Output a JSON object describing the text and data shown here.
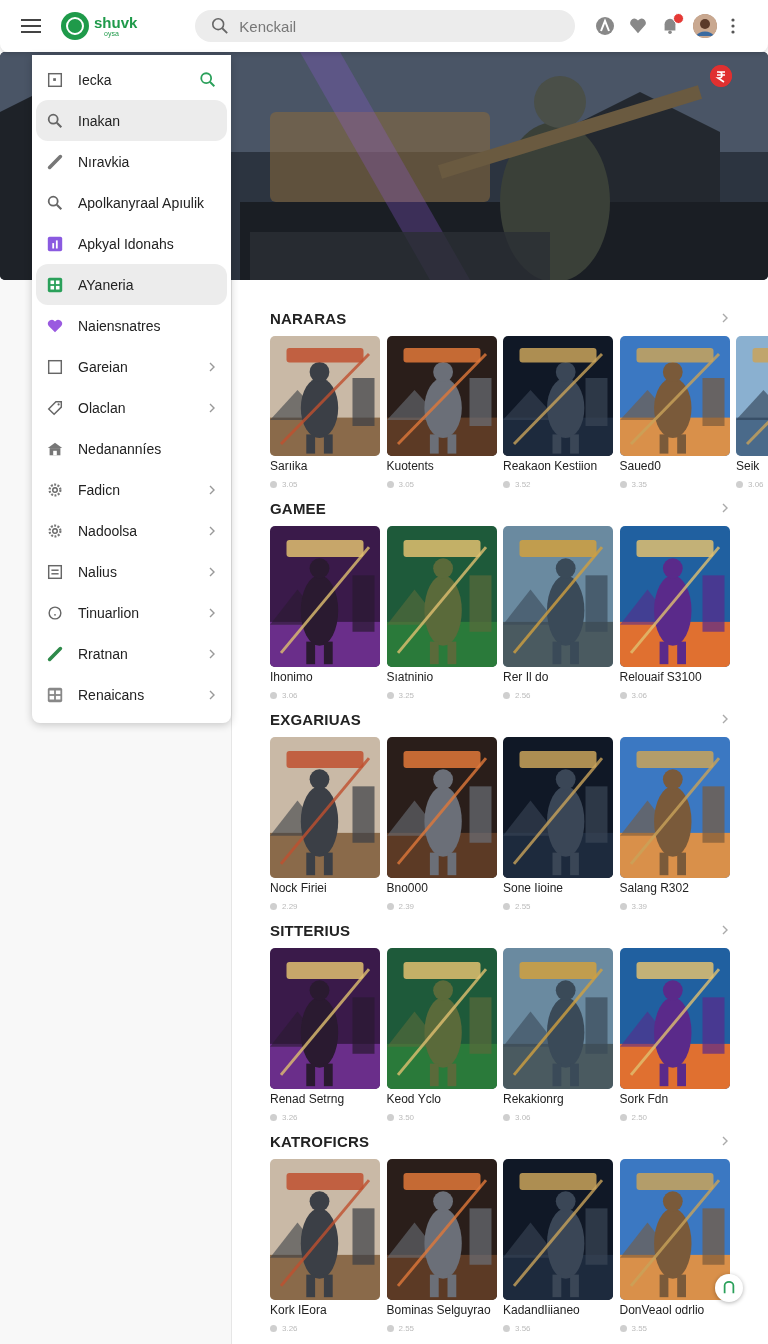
{
  "header": {
    "logo": {
      "name": "shuvk",
      "tagline": "oysa"
    },
    "search": {
      "placeholder": "Kenckail"
    },
    "has_unread_notifications": true
  },
  "menu": {
    "items": [
      {
        "label": "Iecka",
        "selected": false,
        "search_button": true,
        "chevron": false
      },
      {
        "label": "Inakan",
        "selected": true,
        "chevron": false
      },
      {
        "label": "Nıravkia",
        "selected": false,
        "chevron": false
      },
      {
        "label": "Apolkanyraal Apıulik",
        "selected": false,
        "chevron": false
      },
      {
        "label": "Apkyal Idonahs",
        "selected": false,
        "chevron": false
      },
      {
        "label": "AYaneria",
        "selected": true,
        "chevron": false
      },
      {
        "label": "Naiensnatres",
        "selected": false,
        "chevron": false
      },
      {
        "label": "Gareian",
        "selected": false,
        "chevron": true
      },
      {
        "label": "Olaclan",
        "selected": false,
        "chevron": true
      },
      {
        "label": "Nedananníes",
        "selected": false,
        "chevron": false
      },
      {
        "label": "Fadicn",
        "selected": false,
        "chevron": true
      },
      {
        "label": "Nadoolsa",
        "selected": false,
        "chevron": true
      },
      {
        "label": "Nalius",
        "selected": false,
        "chevron": true
      },
      {
        "label": "Tinuarlion",
        "selected": false,
        "chevron": true
      },
      {
        "label": "Rratnan",
        "selected": false,
        "chevron": true
      },
      {
        "label": "Renaicans",
        "selected": false,
        "chevron": true
      }
    ]
  },
  "sections": [
    {
      "title": "NARARAS",
      "kind": "landscape",
      "games": [
        {
          "title": "Sarıika",
          "rating": "3.05"
        },
        {
          "title": "Kuotents",
          "rating": "3.05"
        },
        {
          "title": "Reakaon Kestiion",
          "rating": "3.52"
        },
        {
          "title": "Saued0",
          "rating": "3.35"
        },
        {
          "title": "Seik",
          "rating": "3.06"
        }
      ]
    },
    {
      "title": "GAMEE",
      "kind": "portrait",
      "games": [
        {
          "title": "Ihonimo",
          "rating": "3.06"
        },
        {
          "title": "Sıatninio",
          "rating": "3.25"
        },
        {
          "title": "Rer Il do",
          "rating": "2.56"
        },
        {
          "title": "Relouaif S3100",
          "rating": "3.06"
        }
      ]
    },
    {
      "title": "EXGARIUAS",
      "kind": "portrait",
      "games": [
        {
          "title": "Nock Firiei",
          "rating": "2.29"
        },
        {
          "title": "Bno000",
          "rating": "2.39"
        },
        {
          "title": "Sone Iioine",
          "rating": "2.55"
        },
        {
          "title": "Salang R302",
          "rating": "3.39"
        }
      ]
    },
    {
      "title": "SITTERIUS",
      "kind": "portrait",
      "games": [
        {
          "title": "Renad Setrng",
          "rating": "3.26"
        },
        {
          "title": "Keod Yclo",
          "rating": "3.50"
        },
        {
          "title": "Rekakionrg",
          "rating": "3.06"
        },
        {
          "title": "Sork Fdn",
          "rating": "2.50"
        }
      ]
    },
    {
      "title": "KATROFICRS",
      "kind": "portrait",
      "games": [
        {
          "title": "Kork IEora",
          "rating": "3.26"
        },
        {
          "title": "Bominas Selguyrao",
          "rating": "2.55"
        },
        {
          "title": "KadandIiianeo",
          "rating": "3.56"
        },
        {
          "title": "DonVeaol odrlio",
          "rating": "3.55"
        }
      ]
    }
  ]
}
